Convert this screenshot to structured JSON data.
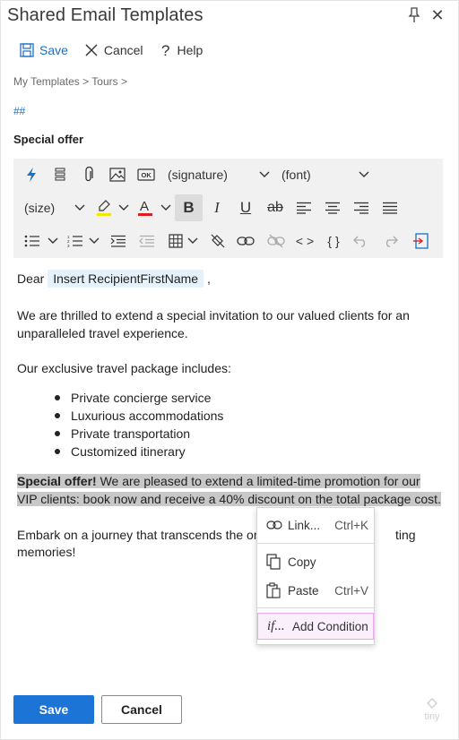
{
  "window": {
    "title": "Shared Email Templates"
  },
  "commands": {
    "save": "Save",
    "cancel": "Cancel",
    "help": "Help"
  },
  "breadcrumb": "My Templates > Tours >",
  "hashtags": "##",
  "template_name": "Special offer",
  "toolbar": {
    "signature_dropdown": "(signature)",
    "font_dropdown": "(font)",
    "size_dropdown": "(size)",
    "bold": "B",
    "italic": "I",
    "underline": "U",
    "strikethrough": "ab",
    "source_code": "< >",
    "braces": "{ }",
    "highlight_color": "#f2e600",
    "font_color": "#e02020"
  },
  "editor": {
    "greeting": "Dear",
    "merge_field": "Insert RecipientFirstName",
    "comma": ",",
    "para1_line1": "We are thrilled to extend a special invitation to our valued clients for an",
    "para1_line2": "unparalleled travel experience.",
    "para2": "Our exclusive travel package includes:",
    "bullets": [
      "Private concierge service",
      "Luxurious accommodations",
      "Private transportation",
      "Customized itinerary"
    ],
    "offer_bold": "Special offer!",
    "offer_line1_rest": " We are pleased to extend a limited-time promotion for our",
    "offer_line2": "VIP clients: book now and receive a 40% discount on the total package cost.",
    "closing_line1_start": "Embark on a journey that transcends the or",
    "closing_line1_end": "ting",
    "closing_line2": "memories!"
  },
  "context_menu": {
    "items": [
      {
        "label": "Link...",
        "shortcut": "Ctrl+K"
      },
      {
        "label": "Copy",
        "shortcut": ""
      },
      {
        "label": "Paste",
        "shortcut": "Ctrl+V"
      },
      {
        "label": "Add Condition",
        "shortcut": ""
      }
    ],
    "condition_icon_text": "if..."
  },
  "footer": {
    "save": "Save",
    "cancel": "Cancel",
    "brand": "tiny"
  },
  "colors": {
    "accent": "#1b74d6",
    "link": "#1a6fc7",
    "selection": "#c8c8c8",
    "merge_chip": "#e6f2fb",
    "condition_highlight": "#e9a8e9"
  }
}
